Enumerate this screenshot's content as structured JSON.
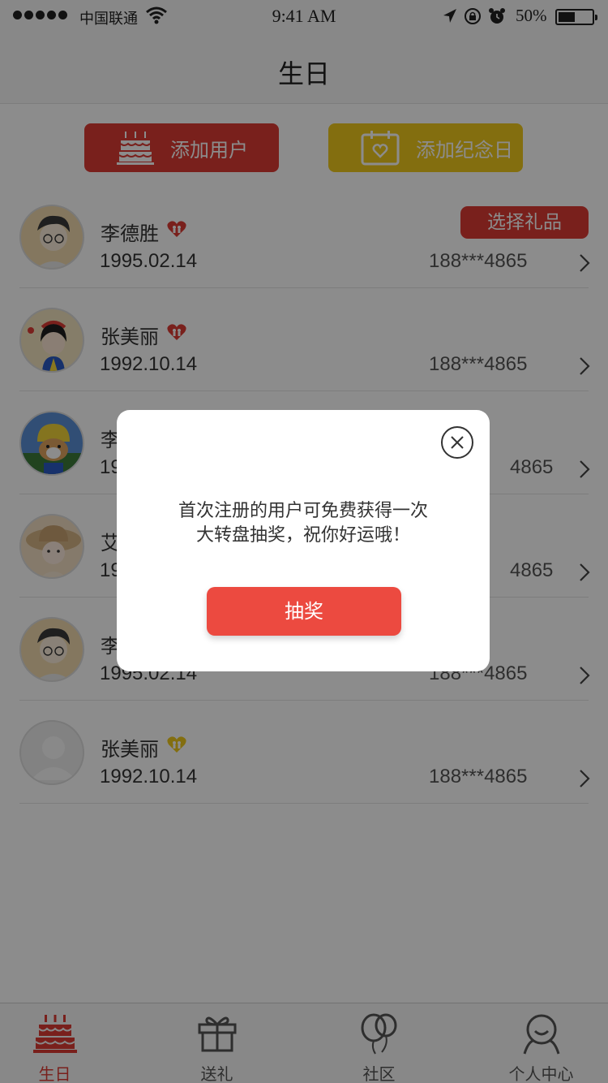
{
  "status_bar": {
    "carrier": "中国联通",
    "time": "9:41 AM",
    "battery": "50%"
  },
  "nav": {
    "title": "生日"
  },
  "actions": {
    "add_user": "添加用户",
    "add_anniversary": "添加纪念日"
  },
  "contacts": [
    {
      "name": "李德胜",
      "date": "1995.02.14",
      "phone": "188***4865",
      "heart_color": "#dd3b34",
      "action": "选择礼品"
    },
    {
      "name": "张美丽",
      "date": "1992.10.14",
      "phone": "188***4865",
      "heart_color": "#dd3b34"
    },
    {
      "name": "李",
      "date": "19",
      "phone": "4865",
      "heart_color": "#dd3b34"
    },
    {
      "name": "艾",
      "date": "19",
      "phone": "4865",
      "heart_color": "#dd3b34"
    },
    {
      "name": "李",
      "date": "1995.02.14",
      "phone": "188***4865",
      "heart_color": "#dd3b34"
    },
    {
      "name": "张美丽",
      "date": "1992.10.14",
      "phone": "188***4865",
      "heart_color": "#eec81d"
    }
  ],
  "tabs": [
    {
      "label": "生日",
      "icon": "cake-icon",
      "active": true
    },
    {
      "label": "送礼",
      "icon": "gift-icon",
      "active": false
    },
    {
      "label": "社区",
      "icon": "balloons-icon",
      "active": false
    },
    {
      "label": "个人中心",
      "icon": "person-icon",
      "active": false
    }
  ],
  "modal": {
    "message_line1": "首次注册的用户可免费获得一次",
    "message_line2": "大转盘抽奖，祝你好运哦！",
    "button": "抽奖"
  },
  "colors": {
    "primary_red": "#dd3b34",
    "accent_yellow": "#eec81d",
    "modal_button": "#ec4a40"
  }
}
